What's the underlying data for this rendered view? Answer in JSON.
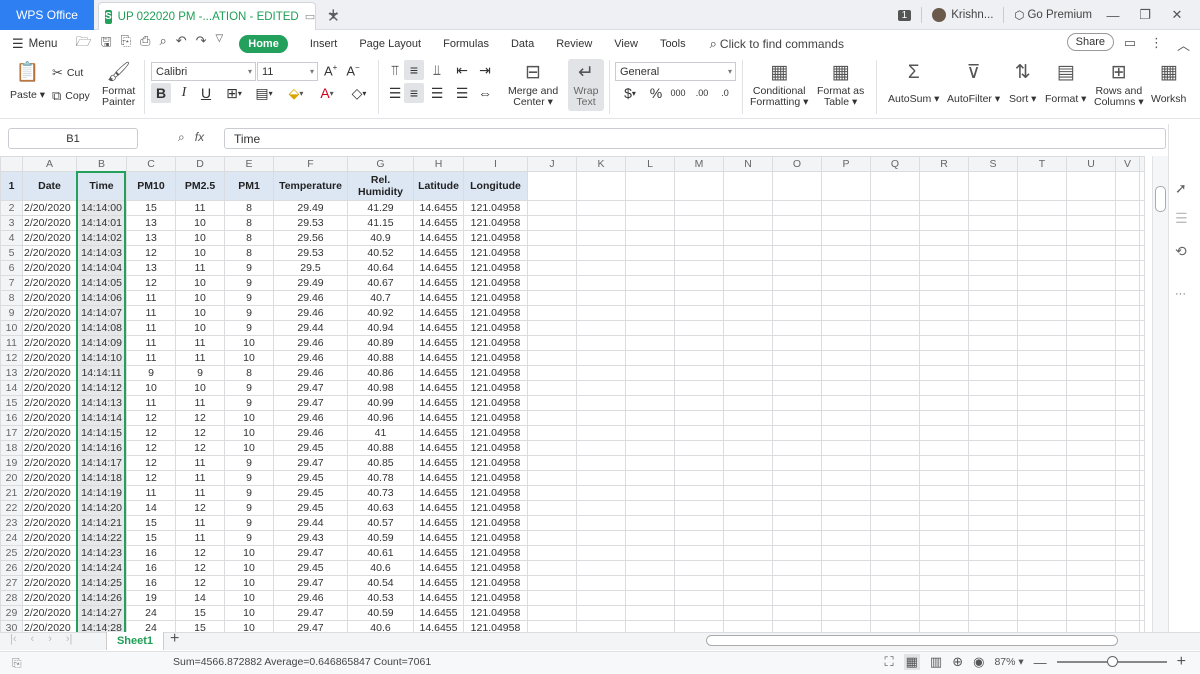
{
  "titlebar": {
    "app_tab": "WPS Office",
    "doc_title": "UP 022020 PM -...ATION - EDITED",
    "window_count": "1",
    "user": "Krishn...",
    "premium": "Go Premium"
  },
  "menu": {
    "menu_label": "Menu",
    "tabs": [
      "Home",
      "Insert",
      "Page Layout",
      "Formulas",
      "Data",
      "Review",
      "View",
      "Tools"
    ],
    "find": "Click to find commands",
    "share": "Share"
  },
  "ribbon": {
    "paste": "Paste",
    "cut": "Cut",
    "copy": "Copy",
    "format_painter_1": "Format",
    "format_painter_2": "Painter",
    "font_name": "Calibri",
    "font_size": "11",
    "merge_1": "Merge and",
    "merge_2": "Center",
    "wrap_1": "Wrap",
    "wrap_2": "Text",
    "number_format": "General",
    "cond_1": "Conditional",
    "cond_2": "Formatting",
    "fat_1": "Format as",
    "fat_2": "Table",
    "autosum": "AutoSum",
    "autofilter": "AutoFilter",
    "sort": "Sort",
    "format": "Format",
    "rows_1": "Rows and",
    "rows_2": "Columns",
    "worksheet": "Worksh"
  },
  "formula_bar": {
    "cell_ref": "B1",
    "fx": "fx",
    "value": "Time"
  },
  "sheet": {
    "columns": [
      "A",
      "B",
      "C",
      "D",
      "E",
      "F",
      "G",
      "H",
      "I",
      "J",
      "K",
      "L",
      "M",
      "N",
      "O",
      "P",
      "Q",
      "R",
      "S",
      "T",
      "U",
      "V"
    ],
    "headers": [
      "Date",
      "Time",
      "PM10",
      "PM2.5",
      "PM1",
      "Temperature",
      "Rel. Humidity",
      "Latitude",
      "Longitude"
    ],
    "rows": [
      [
        "2/20/2020",
        "14:14:00",
        "15",
        "11",
        "8",
        "29.49",
        "41.29",
        "14.6455",
        "121.04958"
      ],
      [
        "2/20/2020",
        "14:14:01",
        "13",
        "10",
        "8",
        "29.53",
        "41.15",
        "14.6455",
        "121.04958"
      ],
      [
        "2/20/2020",
        "14:14:02",
        "13",
        "10",
        "8",
        "29.56",
        "40.9",
        "14.6455",
        "121.04958"
      ],
      [
        "2/20/2020",
        "14:14:03",
        "12",
        "10",
        "8",
        "29.53",
        "40.52",
        "14.6455",
        "121.04958"
      ],
      [
        "2/20/2020",
        "14:14:04",
        "13",
        "11",
        "9",
        "29.5",
        "40.64",
        "14.6455",
        "121.04958"
      ],
      [
        "2/20/2020",
        "14:14:05",
        "12",
        "10",
        "9",
        "29.49",
        "40.67",
        "14.6455",
        "121.04958"
      ],
      [
        "2/20/2020",
        "14:14:06",
        "11",
        "10",
        "9",
        "29.46",
        "40.7",
        "14.6455",
        "121.04958"
      ],
      [
        "2/20/2020",
        "14:14:07",
        "11",
        "10",
        "9",
        "29.46",
        "40.92",
        "14.6455",
        "121.04958"
      ],
      [
        "2/20/2020",
        "14:14:08",
        "11",
        "10",
        "9",
        "29.44",
        "40.94",
        "14.6455",
        "121.04958"
      ],
      [
        "2/20/2020",
        "14:14:09",
        "11",
        "11",
        "10",
        "29.46",
        "40.89",
        "14.6455",
        "121.04958"
      ],
      [
        "2/20/2020",
        "14:14:10",
        "11",
        "11",
        "10",
        "29.46",
        "40.88",
        "14.6455",
        "121.04958"
      ],
      [
        "2/20/2020",
        "14:14:11",
        "9",
        "9",
        "8",
        "29.46",
        "40.86",
        "14.6455",
        "121.04958"
      ],
      [
        "2/20/2020",
        "14:14:12",
        "10",
        "10",
        "9",
        "29.47",
        "40.98",
        "14.6455",
        "121.04958"
      ],
      [
        "2/20/2020",
        "14:14:13",
        "11",
        "11",
        "9",
        "29.47",
        "40.99",
        "14.6455",
        "121.04958"
      ],
      [
        "2/20/2020",
        "14:14:14",
        "12",
        "12",
        "10",
        "29.46",
        "40.96",
        "14.6455",
        "121.04958"
      ],
      [
        "2/20/2020",
        "14:14:15",
        "12",
        "12",
        "10",
        "29.46",
        "41",
        "14.6455",
        "121.04958"
      ],
      [
        "2/20/2020",
        "14:14:16",
        "12",
        "12",
        "10",
        "29.45",
        "40.88",
        "14.6455",
        "121.04958"
      ],
      [
        "2/20/2020",
        "14:14:17",
        "12",
        "11",
        "9",
        "29.47",
        "40.85",
        "14.6455",
        "121.04958"
      ],
      [
        "2/20/2020",
        "14:14:18",
        "12",
        "11",
        "9",
        "29.45",
        "40.78",
        "14.6455",
        "121.04958"
      ],
      [
        "2/20/2020",
        "14:14:19",
        "11",
        "11",
        "9",
        "29.45",
        "40.73",
        "14.6455",
        "121.04958"
      ],
      [
        "2/20/2020",
        "14:14:20",
        "14",
        "12",
        "9",
        "29.45",
        "40.63",
        "14.6455",
        "121.04958"
      ],
      [
        "2/20/2020",
        "14:14:21",
        "15",
        "11",
        "9",
        "29.44",
        "40.57",
        "14.6455",
        "121.04958"
      ],
      [
        "2/20/2020",
        "14:14:22",
        "15",
        "11",
        "9",
        "29.43",
        "40.59",
        "14.6455",
        "121.04958"
      ],
      [
        "2/20/2020",
        "14:14:23",
        "16",
        "12",
        "10",
        "29.47",
        "40.61",
        "14.6455",
        "121.04958"
      ],
      [
        "2/20/2020",
        "14:14:24",
        "16",
        "12",
        "10",
        "29.45",
        "40.6",
        "14.6455",
        "121.04958"
      ],
      [
        "2/20/2020",
        "14:14:25",
        "16",
        "12",
        "10",
        "29.47",
        "40.54",
        "14.6455",
        "121.04958"
      ],
      [
        "2/20/2020",
        "14:14:26",
        "19",
        "14",
        "10",
        "29.46",
        "40.53",
        "14.6455",
        "121.04958"
      ],
      [
        "2/20/2020",
        "14:14:27",
        "24",
        "15",
        "10",
        "29.47",
        "40.59",
        "14.6455",
        "121.04958"
      ],
      [
        "2/20/2020",
        "14:14:28",
        "24",
        "15",
        "10",
        "29.47",
        "40.6",
        "14.6455",
        "121.04958"
      ]
    ]
  },
  "sheet_tabs": {
    "active": "Sheet1"
  },
  "status": {
    "summary": "Sum=4566.872882  Average=0.646865847  Count=7061",
    "zoom": "87%"
  },
  "colors": {
    "accent": "#22a05c",
    "wps_blue": "#2e7ff2",
    "header_fill": "#dde7f4"
  }
}
